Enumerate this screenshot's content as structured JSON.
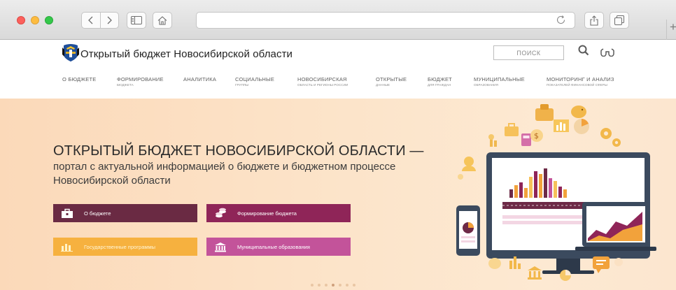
{
  "browser": {
    "nav_back": "<",
    "nav_forward": ">",
    "new_tab_label": "+"
  },
  "header": {
    "title": "Открытый бюджет Новосибирской области",
    "search_placeholder": "ПОИСК"
  },
  "nav": [
    {
      "title": "О БЮДЖЕТЕ",
      "sub": ""
    },
    {
      "title": "ФОРМИРОВАНИЕ",
      "sub": "БЮДЖЕТА"
    },
    {
      "title": "АНАЛИТИКА",
      "sub": ""
    },
    {
      "title": "СОЦИАЛЬНЫЕ",
      "sub": "ГРУППЫ"
    },
    {
      "title": "НОВОСИБИРСКАЯ",
      "sub": "ОБЛАСТЬ И РЕГИОНЫ РОССИИ"
    },
    {
      "title": "ОТКРЫТЫЕ",
      "sub": "ДАННЫЕ"
    },
    {
      "title": "БЮДЖЕТ",
      "sub": "ДЛЯ ГРАЖДАН"
    },
    {
      "title": "МУНИЦИПАЛЬНЫЕ",
      "sub": "ОБРАЗОВАНИЯ"
    },
    {
      "title": "МОНИТОРИНГ И АНАЛИЗ",
      "sub": "ПОКАЗАТЕЛЕЙ ФИНАНСОВОЙ СФЕРЫ"
    }
  ],
  "hero": {
    "title": "ОТКРЫТЫЙ БЮДЖЕТ НОВОСИБИРСКОЙ ОБЛАСТИ —",
    "subtitle_line1": "портал с актуальной информацией о бюджете и бюджетном процессе",
    "subtitle_line2": "Новосибирской области",
    "tiles": [
      {
        "label": "О бюджете",
        "icon": "briefcase-icon",
        "color": "#6a2a43"
      },
      {
        "label": "Формирование бюджета",
        "icon": "coins-icon",
        "color": "#8f2558"
      },
      {
        "label": "Государственные программы",
        "icon": "chart-icon",
        "color": "#f6b13f"
      },
      {
        "label": "Муниципальные образования",
        "icon": "building-icon",
        "color": "#c3539a"
      }
    ],
    "slider_dots": 7,
    "active_dot": 4
  },
  "colors": {
    "hero_bg": "#fce3c8",
    "brand_dark": "#6a2a43",
    "brand_magenta": "#8f2558",
    "accent_yellow": "#f6b13f",
    "accent_pink": "#c3539a"
  }
}
